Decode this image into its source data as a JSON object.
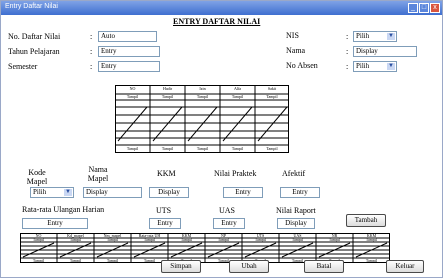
{
  "window": {
    "title": "Entry Daftar Nilai",
    "min": "_",
    "max": "□",
    "close": "x"
  },
  "form_title": "ENTRY DAFTAR NILAI",
  "header": {
    "no_daftar": {
      "label": "No. Daftar Nilai",
      "colon": ":",
      "value": "Auto"
    },
    "tahun": {
      "label": "Tahun Pelajaran",
      "colon": ":",
      "value": "Entry"
    },
    "semester": {
      "label": "Semester",
      "colon": ":",
      "value": "Entry"
    },
    "nis": {
      "label": "NIS",
      "colon": ":",
      "value": "Pilih"
    },
    "nama": {
      "label": "Nama",
      "colon": ":",
      "value": "Display"
    },
    "no_absen": {
      "label": "No Absen",
      "colon": ":",
      "value": "Pilih"
    }
  },
  "absen_table": {
    "columns": [
      "NO",
      "Hadir",
      "Izin",
      "Alfa",
      "Sakit"
    ],
    "sub": [
      "Tampil",
      "Tampil",
      "Tampil",
      "Tampil",
      "Tampil"
    ],
    "footer": [
      "Tampil",
      "Tampil",
      "Tampil",
      "Tampil",
      "Tampil"
    ]
  },
  "mid": {
    "kode_mapel": {
      "label": "Kode Mapel",
      "value": "Pilih"
    },
    "nama_mapel": {
      "label": "Nama Mapel",
      "value": "Display"
    },
    "kkm": {
      "label": "KKM",
      "value": "Display"
    },
    "nilai_praktek": {
      "label": "Nilai Praktek",
      "value": "Entry"
    },
    "afektif": {
      "label": "Afektif",
      "value": "Entry"
    },
    "rata_uh": {
      "label": "Rata-rata Ulangan Harian",
      "value": "Entry"
    },
    "uts": {
      "label": "UTS",
      "value": "Entry"
    },
    "uas": {
      "label": "UAS",
      "value": "Entry"
    },
    "nilai_raport": {
      "label": "Nilai Raport",
      "value": "Display"
    },
    "tambah": "Tambah"
  },
  "nilai_table": {
    "columns": [
      "NO",
      "Kd_mapel",
      "Nm_mapel",
      "Rata-rata UH",
      "KKM",
      "NP",
      "UTS",
      "UAS",
      "NR",
      "KKM"
    ],
    "sub": [
      "Tampil",
      "Tampil",
      "Tampil",
      "Tampil",
      "Tampil",
      "Tampil",
      "Tampil",
      "Tampil",
      "Tampil",
      "Tampil"
    ],
    "footer": [
      "Tampil",
      "Tampil",
      "Tampil",
      "Tampil",
      "Tampil",
      "Tampil",
      "Tampil",
      "Tampil",
      "Tampil",
      "Tampil"
    ]
  },
  "actions": {
    "simpan": "Simpan",
    "ubah": "Ubah",
    "batal": "Batal",
    "keluar": "Keluar"
  }
}
